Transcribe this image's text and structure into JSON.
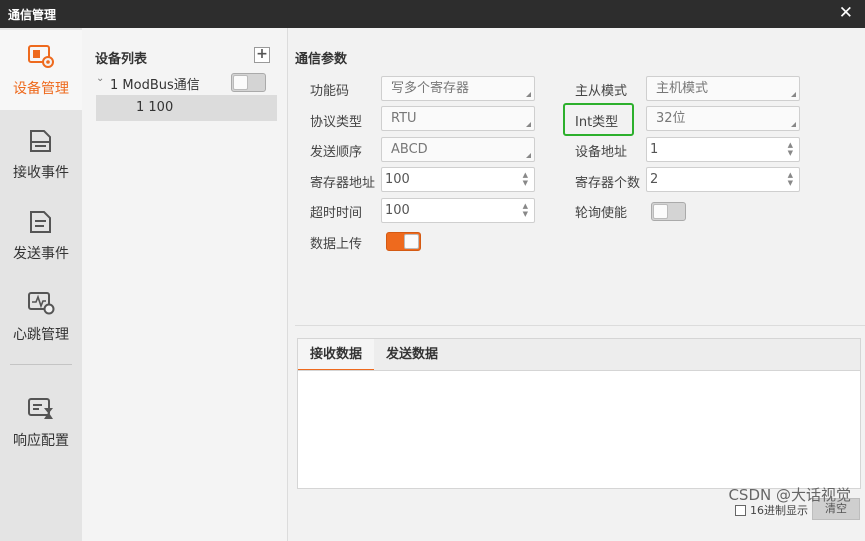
{
  "window": {
    "title": "通信管理",
    "close": "✕"
  },
  "sidebar": {
    "items": [
      {
        "label": "设备管理",
        "icon": "device-management-icon",
        "active": true
      },
      {
        "label": "接收事件",
        "icon": "receive-event-icon"
      },
      {
        "label": "发送事件",
        "icon": "send-event-icon"
      },
      {
        "label": "心跳管理",
        "icon": "heartbeat-icon"
      },
      {
        "label": "响应配置",
        "icon": "response-config-icon"
      }
    ]
  },
  "device_list": {
    "title": "设备列表",
    "add": "+",
    "node": {
      "caret": "⌄",
      "name": "1 ModBus通信",
      "enabled": false
    },
    "child": "1 100"
  },
  "params": {
    "title": "通信参数",
    "function_code": {
      "label": "功能码",
      "value": "写多个寄存器"
    },
    "protocol": {
      "label": "协议类型",
      "value": "RTU"
    },
    "send_order": {
      "label": "发送顺序",
      "value": "ABCD"
    },
    "register_address": {
      "label": "寄存器地址",
      "value": "100"
    },
    "timeout": {
      "label": "超时时间",
      "value": "100"
    },
    "upload": {
      "label": "数据上传",
      "enabled": true
    },
    "master_slave": {
      "label": "主从模式",
      "value": "主机模式"
    },
    "int_type": {
      "label": "Int类型",
      "value": "32位"
    },
    "device_address": {
      "label": "设备地址",
      "value": "1"
    },
    "register_count": {
      "label": "寄存器个数",
      "value": "2"
    },
    "polling": {
      "label": "轮询使能",
      "enabled": false
    }
  },
  "data_panel": {
    "tabs": [
      "接收数据",
      "发送数据"
    ],
    "active_tab": 0,
    "hex_label": "16进制显示",
    "clear": "清空"
  },
  "watermark": "CSDN @大话视觉",
  "colors": {
    "accent": "#ee6a1e",
    "highlight": "#2db02d",
    "titlebar": "#2d2d2d"
  }
}
